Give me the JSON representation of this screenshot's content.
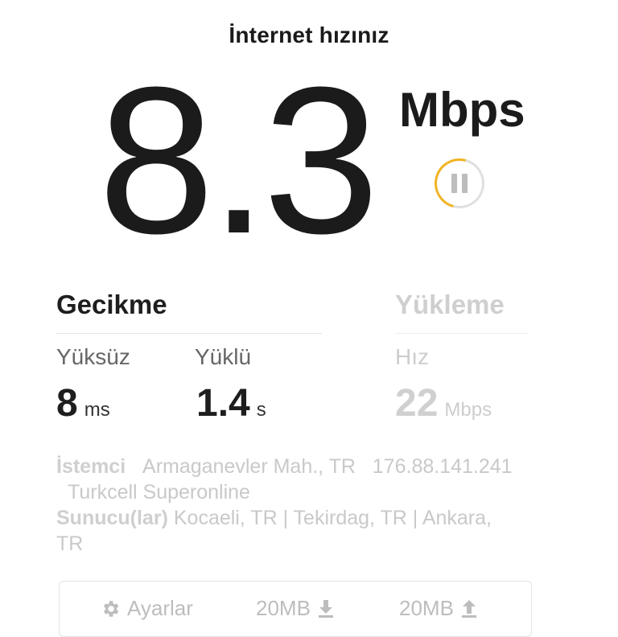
{
  "header": {
    "title": "İnternet hızınız"
  },
  "speed": {
    "value": "8.3",
    "unit": "Mbps"
  },
  "latency": {
    "heading": "Gecikme",
    "unloaded": {
      "label": "Yüksüz",
      "value": "8",
      "unit": "ms"
    },
    "loaded": {
      "label": "Yüklü",
      "value": "1.4",
      "unit": "s"
    }
  },
  "upload": {
    "heading": "Yükleme",
    "speed": {
      "label": "Hız",
      "value": "22",
      "unit": "Mbps"
    }
  },
  "info": {
    "client_label": "İstemci",
    "client_location": "Armaganevler Mah., TR",
    "client_ip": "176.88.141.241",
    "client_isp": "Turkcell Superonline",
    "server_label": "Sunucu(lar)",
    "servers_line1": "Kocaeli, TR  |  Tekirdag, TR  |  Ankara,",
    "servers_line2": "TR"
  },
  "bottom_bar": {
    "settings_label": "Ayarlar",
    "download_size": "20MB",
    "upload_size": "20MB"
  },
  "colors": {
    "accent": "#f0b323",
    "text": "#1b1b1b",
    "muted": "#c9c9c9"
  },
  "icons": {
    "pause": "pause-icon",
    "settings": "gear-icon",
    "download": "download-arrow-icon",
    "upload": "upload-arrow-icon"
  }
}
